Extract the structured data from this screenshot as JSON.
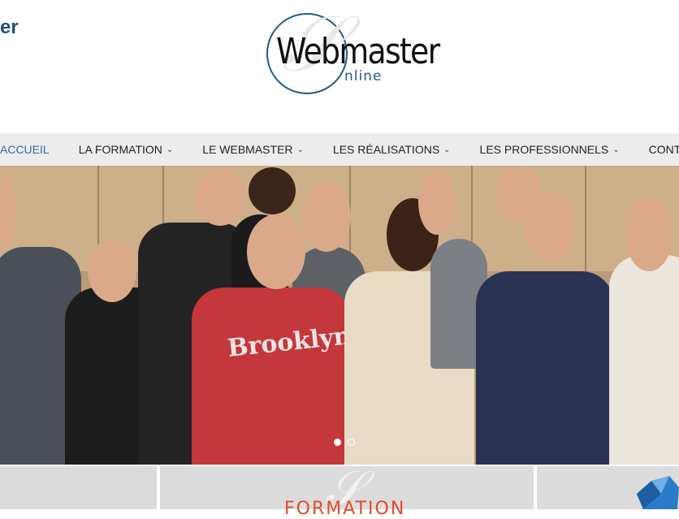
{
  "header": {
    "corner_fragment": "er",
    "logo": {
      "title": "Webmaster",
      "subtitle": "nline"
    }
  },
  "nav": {
    "items": [
      {
        "label": "ACCUEIL",
        "active": true,
        "has_dropdown": false
      },
      {
        "label": "LA FORMATION",
        "active": false,
        "has_dropdown": true
      },
      {
        "label": "LE WEBMASTER",
        "active": false,
        "has_dropdown": true
      },
      {
        "label": "LES RÉALISATIONS",
        "active": false,
        "has_dropdown": true
      },
      {
        "label": "LES PROFESSIONNELS",
        "active": false,
        "has_dropdown": true
      },
      {
        "label": "CONTACT",
        "active": false,
        "has_dropdown": false
      }
    ],
    "dropdown_icon": "chevron-down-icon"
  },
  "hero": {
    "image_description_text": "Brooklyn",
    "slides": {
      "count": 2,
      "current": 1
    }
  },
  "panels": {
    "formation_title": "FORMATION"
  },
  "colors": {
    "brand_blue": "#1f5b86",
    "active_link": "#2a6aa3",
    "accent_red": "#e04b2b",
    "nav_bg": "#ededed"
  }
}
